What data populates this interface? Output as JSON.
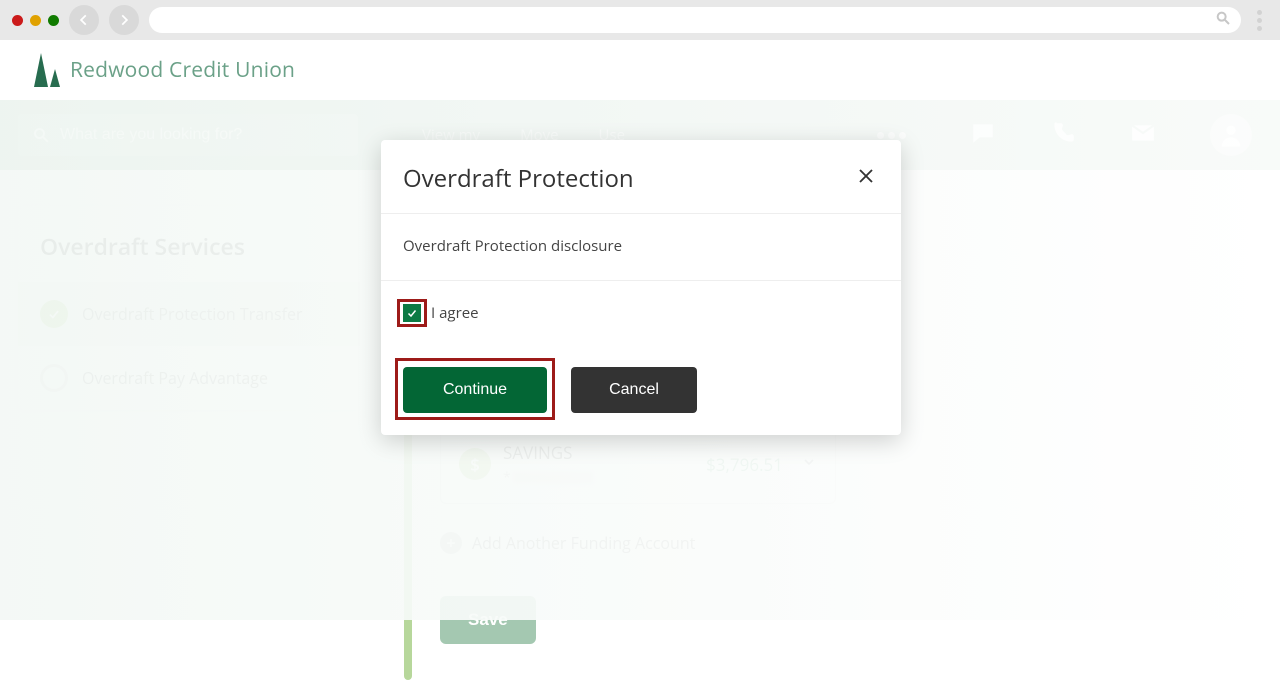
{
  "brand": {
    "name": "Redwood Credit Union"
  },
  "search": {
    "placeholder": "What are you looking for?"
  },
  "nav": {
    "links": [
      "View my",
      "Move",
      "Use"
    ]
  },
  "sidebar": {
    "title": "Overdraft Services",
    "items": [
      {
        "label": "Overdraft Protection Transfer",
        "active": true
      },
      {
        "label": "Overdraft Pay Advantage",
        "active": false
      }
    ]
  },
  "account": {
    "name": "SAVINGS",
    "mask_prefix": "*",
    "balance": "$3,796.51"
  },
  "add_another": "Add Another Funding Account",
  "save_label": "Save",
  "modal": {
    "title": "Overdraft Protection",
    "subtitle": "Overdraft Protection disclosure",
    "agree_label": "I agree",
    "continue_label": "Continue",
    "cancel_label": "Cancel"
  }
}
